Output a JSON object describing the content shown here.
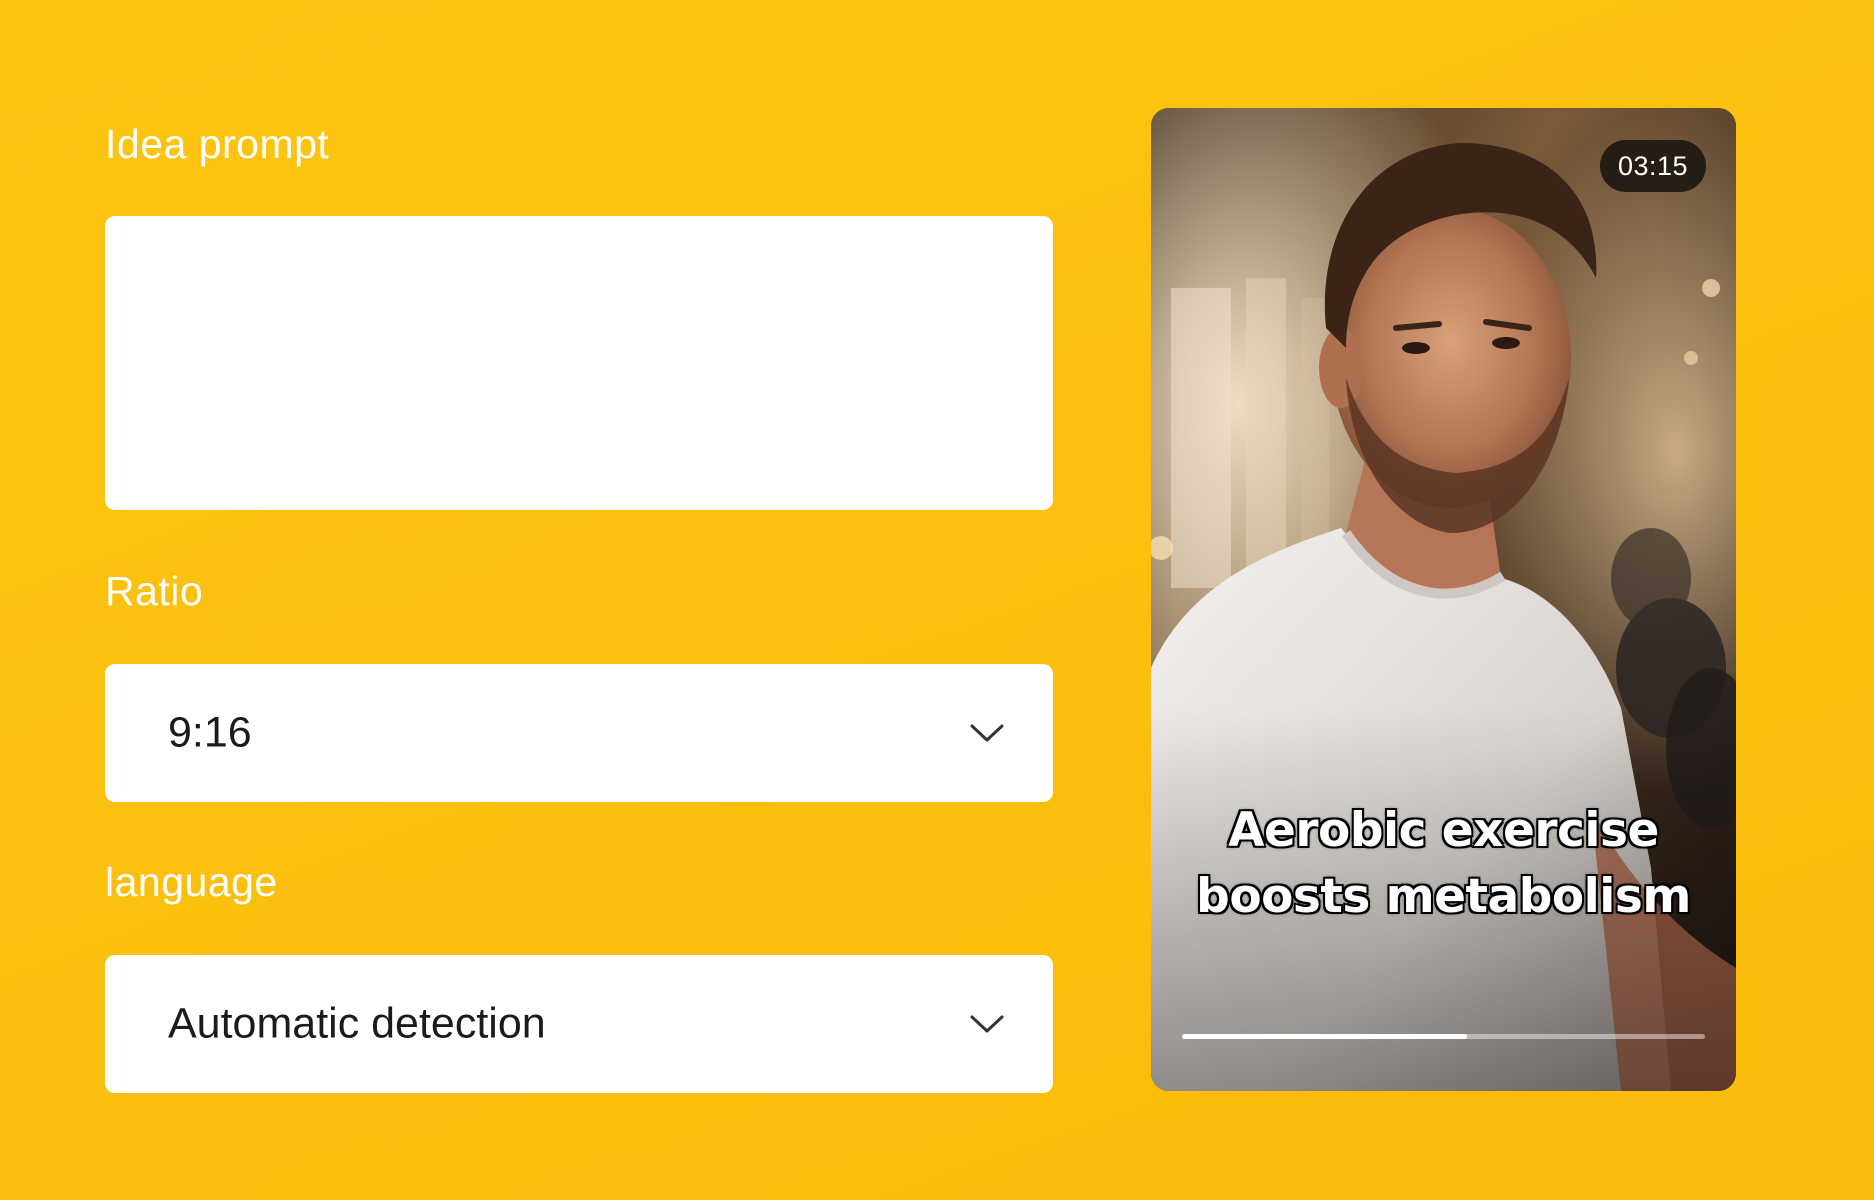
{
  "form": {
    "idea_prompt": {
      "label": "Idea prompt",
      "value": "",
      "placeholder": ""
    },
    "ratio": {
      "label": "Ratio",
      "selected": "9:16",
      "icon": "chevron-down-icon"
    },
    "language": {
      "label": "language",
      "selected": "Automatic detection",
      "icon": "chevron-down-icon"
    }
  },
  "video_preview": {
    "duration": "03:15",
    "caption_line1": "Aerobic exercise",
    "caption_line2": "boosts metabolism",
    "progress": 0.545
  },
  "colors": {
    "background": "#fbc00f",
    "input_background": "#ffffff",
    "label_text": "#ffffff",
    "badge_background": "#14100e"
  }
}
